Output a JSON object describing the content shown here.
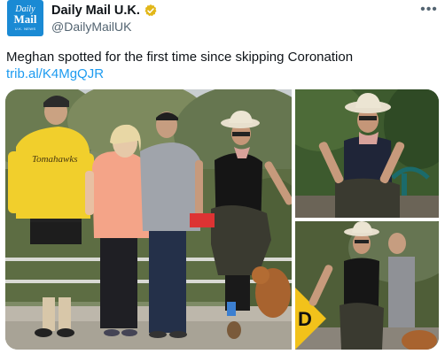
{
  "account": {
    "avatar_line1": "Daily",
    "avatar_line2": "Mail",
    "avatar_line3": "U.K. NEWS",
    "display_name": "Daily Mail U.K.",
    "handle": "@DailyMailUK",
    "verified": true
  },
  "tweet": {
    "text": "Meghan spotted for the first time since skipping Coronation",
    "link": "trib.al/K4MgQJR"
  },
  "media": {
    "photo_count": 3,
    "sweatshirt_text": "Tomahawks",
    "sign_text": "D"
  },
  "colors": {
    "link": "#1d9bf0",
    "verified_badge": "#e2b719",
    "avatar_bg": "#1a8ad4",
    "secondary_text": "#536471"
  },
  "icons": {
    "verified": "verified-badge-icon",
    "more": "more-options-icon"
  }
}
